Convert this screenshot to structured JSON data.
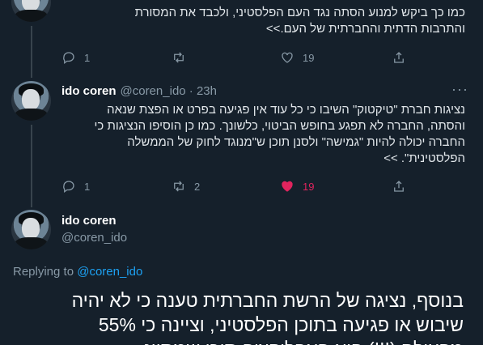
{
  "tweet1": {
    "text_line1": "כמו כך ביקש למנוע הסתה נגד העם הפלסטיני, ולכבד את המסורת",
    "text_line2": "והתרבות הדתית והחברתית של העם.>>",
    "reply_count": "1",
    "like_count": "19"
  },
  "tweet2": {
    "name": "ido coren",
    "handle": "@coren_ido · 23h",
    "more": "···",
    "lines": [
      "נציגות חברת \"טיקטוק\" השיבו כי כל עוד אין פגיעה בפרט או הפצת שנאה",
      "והסתה, החברה לא תפגע בחופש הביטוי, כלשונך. כמו כן הוסיפו הנציגות כי",
      "החברה יכולה להיות \"גמישה\" ולסנן תוכן ש\"מנוגד לחוק של הממשלה",
      "הפלסטינית\". >>"
    ],
    "reply_count": "1",
    "retweet_count": "2",
    "like_count": "19"
  },
  "main_tweet": {
    "name": "ido coren",
    "handle": "@coren_ido",
    "replying_prefix": "Replying to",
    "replying_handle": "@coren_ido",
    "line1": "בנוסף,  נציגה של הרשת החברתית טענה כי לא יהיה",
    "line2": "שיבוש או פגיעה בתוכן הפלסטיני, וציינה כי 55%",
    "line3": "מהעולם (!!!) הוא האפליקציה תוכן שמתיינ"
  },
  "colors": {
    "background": "#15202b",
    "accent": "#1da1f2",
    "like_active": "#e0245e",
    "muted": "#8899a6"
  },
  "icons": [
    "reply-icon",
    "retweet-icon",
    "like-icon",
    "share-icon",
    "more-icon"
  ]
}
